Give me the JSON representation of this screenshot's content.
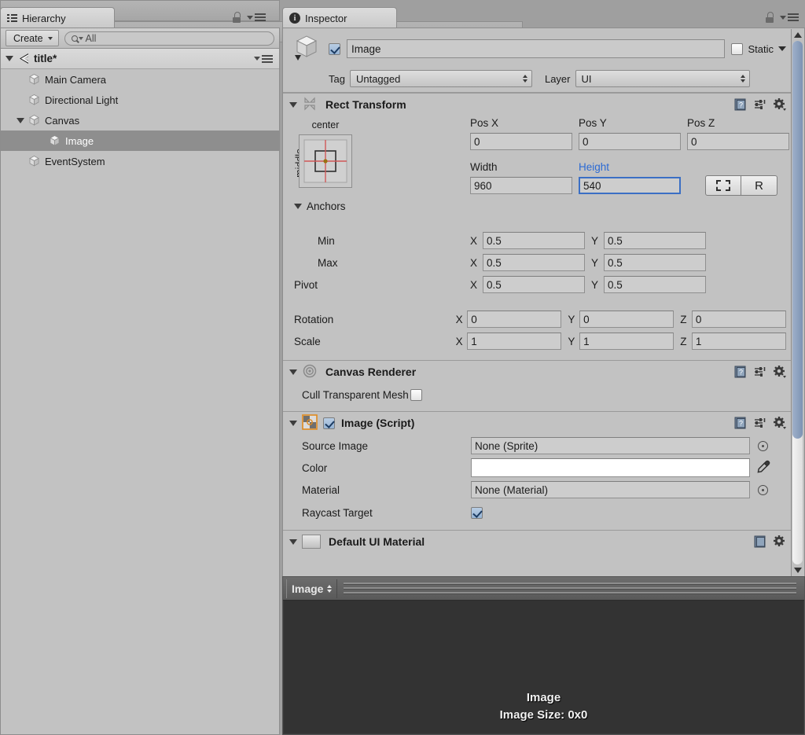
{
  "hierarchy": {
    "tab_label": "Hierarchy",
    "tab_icon": "list-icon",
    "lock_icon": "lock-icon",
    "menu_icon": "menu-icon",
    "create_label": "Create",
    "search_placeholder": "All",
    "search_value": "",
    "scene_name": "title*",
    "items": [
      {
        "label": "Main Camera",
        "depth": 1,
        "expandable": false,
        "selected": false
      },
      {
        "label": "Directional Light",
        "depth": 1,
        "expandable": false,
        "selected": false
      },
      {
        "label": "Canvas",
        "depth": 1,
        "expandable": true,
        "selected": false
      },
      {
        "label": "Image",
        "depth": 2,
        "expandable": false,
        "selected": true
      },
      {
        "label": "EventSystem",
        "depth": 1,
        "expandable": false,
        "selected": false
      }
    ]
  },
  "inspector": {
    "tab_label": "Inspector",
    "tab_icon": "info-icon",
    "lock_icon": "lock-icon",
    "menu_icon": "menu-icon",
    "object": {
      "enabled": true,
      "name": "Image",
      "static_label": "Static",
      "static_checked": false,
      "tag_label": "Tag",
      "tag_value": "Untagged",
      "layer_label": "Layer",
      "layer_value": "UI"
    },
    "rect_transform": {
      "title": "Rect Transform",
      "expanded": true,
      "anchor_preset_top": "center",
      "anchor_preset_left": "middle",
      "columns": [
        "Pos X",
        "Pos Y",
        "Pos Z"
      ],
      "pos": [
        "0",
        "0",
        "0"
      ],
      "size_columns": [
        "Width",
        "Height"
      ],
      "size": [
        "960",
        "540"
      ],
      "focused_field": "Height",
      "blueprint_button": "blueprint-icon",
      "raw_button": "R",
      "anchors_label": "Anchors",
      "anchors_expanded": true,
      "rows": [
        {
          "label": "Min",
          "fields": [
            {
              "axis": "X",
              "value": "0.5"
            },
            {
              "axis": "Y",
              "value": "0.5"
            }
          ]
        },
        {
          "label": "Max",
          "fields": [
            {
              "axis": "X",
              "value": "0.5"
            },
            {
              "axis": "Y",
              "value": "0.5"
            }
          ]
        },
        {
          "label": "Pivot",
          "fields": [
            {
              "axis": "X",
              "value": "0.5"
            },
            {
              "axis": "Y",
              "value": "0.5"
            }
          ]
        },
        {
          "label": "Rotation",
          "fields": [
            {
              "axis": "X",
              "value": "0"
            },
            {
              "axis": "Y",
              "value": "0"
            },
            {
              "axis": "Z",
              "value": "0"
            }
          ]
        },
        {
          "label": "Scale",
          "fields": [
            {
              "axis": "X",
              "value": "1"
            },
            {
              "axis": "Y",
              "value": "1"
            },
            {
              "axis": "Z",
              "value": "1"
            }
          ]
        }
      ]
    },
    "canvas_renderer": {
      "title": "Canvas Renderer",
      "expanded": true,
      "cull_label": "Cull Transparent Mesh",
      "cull_checked": false
    },
    "image_script": {
      "title": "Image (Script)",
      "expanded": true,
      "enabled": true,
      "source_image_label": "Source Image",
      "source_image_value": "None (Sprite)",
      "color_label": "Color",
      "color_value": "#FFFFFF",
      "material_label": "Material",
      "material_value": "None (Material)",
      "raycast_label": "Raycast Target",
      "raycast_checked": true
    },
    "clipped_section": {
      "title": "Default UI Material"
    }
  },
  "preview": {
    "title": "Image",
    "line1": "Image",
    "line2": "Image Size: 0x0"
  },
  "colors": {
    "panel_bg": "#c2c2c2",
    "selection": "#8e8e8e",
    "focus_blue": "#3b6fc4",
    "label_blue": "#2b6ad4",
    "preview_bg": "#333333",
    "scrollbar_thumb": "#7d93b4"
  }
}
